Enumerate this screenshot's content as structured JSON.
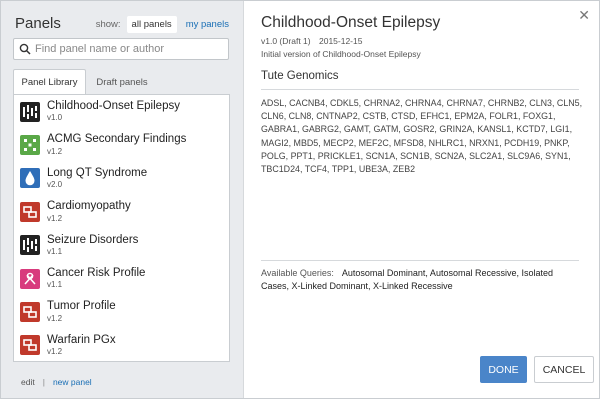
{
  "left": {
    "title": "Panels",
    "show_label": "show:",
    "show_options": [
      "all panels",
      "my panels"
    ],
    "search_placeholder": "Find panel name or author",
    "tabs": [
      "Panel Library",
      "Draft panels"
    ],
    "items": [
      {
        "name": "Childhood-Onset Epilepsy",
        "version": "v1.0",
        "icon": "brain-signal-icon",
        "color": "#222222"
      },
      {
        "name": "ACMG Secondary Findings",
        "version": "v1.2",
        "icon": "grid-cross-icon",
        "color": "#5aa847"
      },
      {
        "name": "Long QT Syndrome",
        "version": "v2.0",
        "icon": "drop-icon",
        "color": "#2f6eb8"
      },
      {
        "name": "Cardiomyopathy",
        "version": "v1.2",
        "icon": "heart-link-icon",
        "color": "#c0392b"
      },
      {
        "name": "Seizure Disorders",
        "version": "v1.1",
        "icon": "brain-signal-icon",
        "color": "#222222"
      },
      {
        "name": "Cancer Risk Profile",
        "version": "v1.1",
        "icon": "ribbon-icon",
        "color": "#d83b7d"
      },
      {
        "name": "Tumor Profile",
        "version": "v1.2",
        "icon": "heart-link-icon",
        "color": "#c0392b"
      },
      {
        "name": "Warfarin PGx",
        "version": "v1.2",
        "icon": "heart-link-icon",
        "color": "#c0392b"
      }
    ],
    "edit_label": "edit",
    "separator": "|",
    "new_panel_label": "new panel"
  },
  "right": {
    "close_glyph": "✕",
    "title": "Childhood-Onset Epilepsy",
    "version": "v1.0 (Draft 1)",
    "date": "2015-12-15",
    "description": "Initial version of Childhood-Onset Epilepsy",
    "subtitle": "Tute Genomics",
    "genes": "ADSL, CACNB4, CDKL5, CHRNA2, CHRNA4, CHRNA7, CHRNB2, CLN3, CLN5, CLN6, CLN8, CNTNAP2, CSTB, CTSD, EFHC1, EPM2A, FOLR1, FOXG1, GABRA1, GABRG2, GAMT, GATM, GOSR2, GRIN2A, KANSL1, KCTD7, LGI1, MAGI2, MBD5, MECP2, MEF2C, MFSD8, NHLRC1, NRXN1, PCDH19, PNKP, POLG, PPT1, PRICKLE1, SCN1A, SCN1B, SCN2A, SLC2A1, SLC9A6, SYN1, TBC1D24, TCF4, TPP1, UBE3A, ZEB2",
    "queries_label": "Available Queries:",
    "queries_value": "Autosomal Dominant, Autosomal Recessive, Isolated Cases, X-Linked Dominant, X-Linked Recessive",
    "done_label": "DONE",
    "cancel_label": "CANCEL"
  }
}
